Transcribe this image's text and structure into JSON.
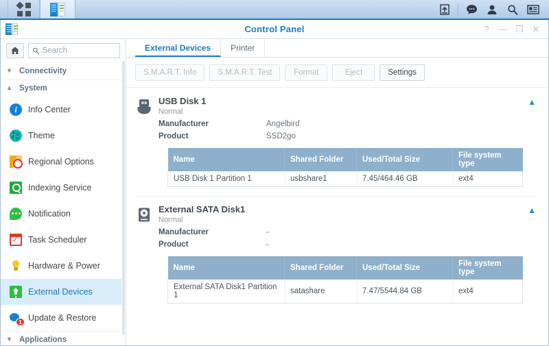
{
  "taskbar": {
    "apps_menu_label": "apps-grid",
    "open_app": "Control Panel",
    "right_icons": [
      "upload-icon",
      "chat-icon",
      "user-icon",
      "search-icon",
      "notification-icon"
    ]
  },
  "window": {
    "title": "Control Panel",
    "controls": {
      "help": "?",
      "minimize": "—",
      "maximize": "❐",
      "close": "✕"
    }
  },
  "sidebar": {
    "home_label": "Home",
    "search": {
      "value": "",
      "placeholder": "Search"
    },
    "groups": [
      {
        "label": "Connectivity",
        "expanded": false,
        "chevron": "chevron-down"
      },
      {
        "label": "System",
        "expanded": true,
        "chevron": "chevron-up"
      }
    ],
    "items": [
      {
        "label": "Info Center",
        "icon": "info-icon",
        "active": false
      },
      {
        "label": "Theme",
        "icon": "theme-palette-icon",
        "active": false
      },
      {
        "label": "Regional Options",
        "icon": "regional-options-icon",
        "active": false
      },
      {
        "label": "Indexing Service",
        "icon": "indexing-service-icon",
        "active": false
      },
      {
        "label": "Notification",
        "icon": "notification-icon",
        "active": false
      },
      {
        "label": "Task Scheduler",
        "icon": "task-scheduler-icon",
        "active": false
      },
      {
        "label": "Hardware & Power",
        "icon": "hardware-power-icon",
        "active": false
      },
      {
        "label": "External Devices",
        "icon": "external-devices-icon",
        "active": true
      },
      {
        "label": "Update & Restore",
        "icon": "update-restore-icon",
        "active": false,
        "badge": "1"
      }
    ],
    "footer_group": {
      "label": "Applications",
      "expanded": false,
      "chevron": "chevron-down"
    }
  },
  "main": {
    "tabs": [
      {
        "label": "External Devices",
        "active": true
      },
      {
        "label": "Printer",
        "active": false
      }
    ],
    "toolbar": [
      {
        "label": "S.M.A.R.T. Info",
        "disabled": true
      },
      {
        "label": "S.M.A.R.T. Test",
        "disabled": true
      },
      {
        "label": "Format",
        "disabled": true
      },
      {
        "label": "Eject",
        "disabled": true
      },
      {
        "label": "Settings",
        "disabled": false
      }
    ],
    "table_headers": [
      "Name",
      "Shared Folder",
      "Used/Total Size",
      "File system type"
    ],
    "devices": [
      {
        "name": "USB Disk 1",
        "status": "Normal",
        "icon": "usb-drive-icon",
        "collapse": "chevron-up",
        "fields": [
          {
            "key": "Manufacturer",
            "value": "Angelbird"
          },
          {
            "key": "Product",
            "value": "SSD2go"
          }
        ],
        "partitions": [
          {
            "name": "USB Disk 1 Partition 1",
            "shared_folder": "usbshare1",
            "used_total": "7.45/464.46 GB",
            "fs_type": "ext4"
          }
        ]
      },
      {
        "name": "External SATA Disk1",
        "status": "Normal",
        "icon": "hard-disk-icon",
        "collapse": "chevron-up",
        "fields": [
          {
            "key": "Manufacturer",
            "value": "-"
          },
          {
            "key": "Product",
            "value": "-"
          }
        ],
        "partitions": [
          {
            "name": "External SATA Disk1 Partition 1",
            "shared_folder": "satashare",
            "used_total": "7.47/5544.84 GB",
            "fs_type": "ext4"
          }
        ]
      }
    ]
  },
  "colors": {
    "accent": "#1b7bc4",
    "taskbar": "#bed5ec",
    "table_header": "#8fb0cb",
    "selected_nav": "#d9ecf9",
    "badge": "#e0392b"
  }
}
